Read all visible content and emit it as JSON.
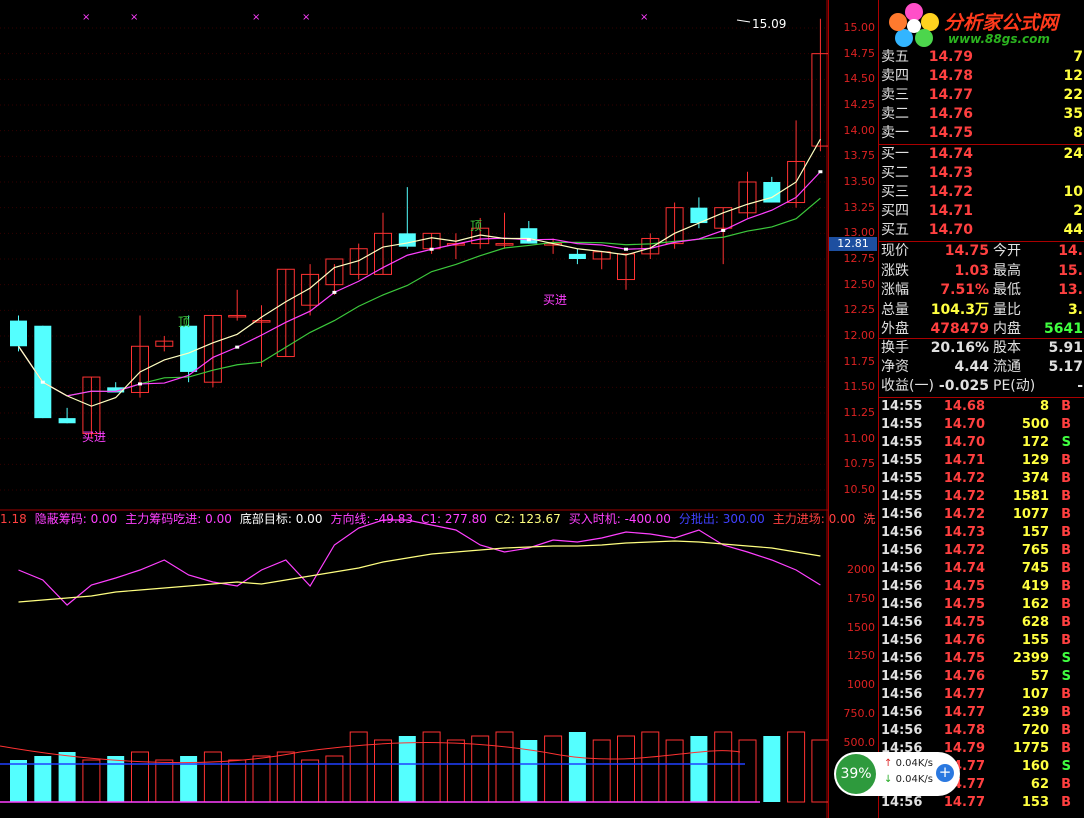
{
  "colors": {
    "up": "#ff3232",
    "down": "#54ffff",
    "ma5": "#ffffc0",
    "ma10": "#ff40ff",
    "ma20": "#3cc83c",
    "grid": "#a00000"
  },
  "chart": {
    "price_axis": [
      "15.00",
      "14.75",
      "14.50",
      "14.25",
      "14.00",
      "13.75",
      "13.50",
      "13.25",
      "13.00",
      "12.75",
      "12.50",
      "12.25",
      "12.00",
      "11.75",
      "11.50",
      "11.25",
      "11.00",
      "10.75",
      "10.50"
    ],
    "current_price_tag": "12.81",
    "high_label": "15.09",
    "signals": {
      "buy1": "买进",
      "buy2": "买进",
      "top1": "顶",
      "top2": "顶"
    },
    "indicator_axis": [
      "2000",
      "1750",
      "1500",
      "1250",
      "1000",
      "750.0",
      "500.0"
    ],
    "indicator_legend": [
      {
        "text": "1.18",
        "color": "#ff4040"
      },
      {
        "text": "隐蔽筹码: 0.00",
        "color": "#ff40ff"
      },
      {
        "text": "主力筹码吃进: 0.00",
        "color": "#ff40ff"
      },
      {
        "text": "底部目标: 0.00",
        "color": "#ffffff"
      },
      {
        "text": "方向线: -49.83",
        "color": "#ff40ff"
      },
      {
        "text": "C1: 277.80",
        "color": "#ff40ff"
      },
      {
        "text": "C2: 123.67",
        "color": "#ffff80"
      },
      {
        "text": "买入时机: -400.00",
        "color": "#ff40ff"
      },
      {
        "text": "分批出: 300.00",
        "color": "#4040ff"
      },
      {
        "text": "主力进场: 0.00",
        "color": "#ff4040"
      },
      {
        "text": "洗",
        "color": "#ff4040"
      }
    ]
  },
  "chart_data": {
    "type": "candlestick",
    "candles": [
      {
        "o": 12.15,
        "h": 12.2,
        "l": 11.85,
        "c": 11.9
      },
      {
        "o": 12.1,
        "h": 12.1,
        "l": 11.2,
        "c": 11.2
      },
      {
        "o": 11.2,
        "h": 11.3,
        "l": 11.15,
        "c": 11.15
      },
      {
        "o": 11.05,
        "h": 11.6,
        "l": 11.0,
        "c": 11.6
      },
      {
        "o": 11.5,
        "h": 11.55,
        "l": 11.45,
        "c": 11.45
      },
      {
        "o": 11.45,
        "h": 12.2,
        "l": 11.4,
        "c": 11.9
      },
      {
        "o": 11.9,
        "h": 12.0,
        "l": 11.85,
        "c": 11.95
      },
      {
        "o": 12.1,
        "h": 12.2,
        "l": 11.55,
        "c": 11.65
      },
      {
        "o": 11.55,
        "h": 12.2,
        "l": 11.5,
        "c": 12.2
      },
      {
        "o": 12.2,
        "h": 12.45,
        "l": 12.15,
        "c": 12.2
      },
      {
        "o": 12.15,
        "h": 12.3,
        "l": 11.7,
        "c": 12.15
      },
      {
        "o": 11.8,
        "h": 12.65,
        "l": 11.8,
        "c": 12.65
      },
      {
        "o": 12.3,
        "h": 12.7,
        "l": 12.2,
        "c": 12.6
      },
      {
        "o": 12.5,
        "h": 12.7,
        "l": 12.4,
        "c": 12.75
      },
      {
        "o": 12.6,
        "h": 12.9,
        "l": 12.55,
        "c": 12.85
      },
      {
        "o": 12.6,
        "h": 13.2,
        "l": 12.6,
        "c": 13.0
      },
      {
        "o": 13.0,
        "h": 13.45,
        "l": 12.85,
        "c": 12.87
      },
      {
        "o": 12.85,
        "h": 13.0,
        "l": 12.8,
        "c": 13.0
      },
      {
        "o": 12.9,
        "h": 13.0,
        "l": 12.75,
        "c": 12.9
      },
      {
        "o": 12.9,
        "h": 13.15,
        "l": 12.85,
        "c": 13.05
      },
      {
        "o": 12.9,
        "h": 13.2,
        "l": 12.85,
        "c": 12.9
      },
      {
        "o": 13.05,
        "h": 13.12,
        "l": 12.9,
        "c": 12.9
      },
      {
        "o": 12.9,
        "h": 12.95,
        "l": 12.8,
        "c": 12.9
      },
      {
        "o": 12.8,
        "h": 12.85,
        "l": 12.7,
        "c": 12.75
      },
      {
        "o": 12.75,
        "h": 12.82,
        "l": 12.65,
        "c": 12.82
      },
      {
        "o": 12.55,
        "h": 12.8,
        "l": 12.45,
        "c": 12.8
      },
      {
        "o": 12.8,
        "h": 13.0,
        "l": 12.75,
        "c": 12.95
      },
      {
        "o": 12.9,
        "h": 13.3,
        "l": 12.85,
        "c": 13.25
      },
      {
        "o": 13.25,
        "h": 13.35,
        "l": 13.05,
        "c": 13.1
      },
      {
        "o": 13.05,
        "h": 13.25,
        "l": 12.7,
        "c": 13.25
      },
      {
        "o": 13.2,
        "h": 13.6,
        "l": 13.15,
        "c": 13.5
      },
      {
        "o": 13.5,
        "h": 13.55,
        "l": 13.3,
        "c": 13.3
      },
      {
        "o": 13.3,
        "h": 14.1,
        "l": 13.25,
        "c": 13.7
      },
      {
        "o": 13.85,
        "h": 15.09,
        "l": 13.8,
        "c": 14.75
      }
    ]
  },
  "quote": {
    "asks": [
      {
        "label": "卖五",
        "price": "14.79",
        "vol": "7"
      },
      {
        "label": "卖四",
        "price": "14.78",
        "vol": "12"
      },
      {
        "label": "卖三",
        "price": "14.77",
        "vol": "22"
      },
      {
        "label": "卖二",
        "price": "14.76",
        "vol": "35"
      },
      {
        "label": "卖一",
        "price": "14.75",
        "vol": "8"
      }
    ],
    "bids": [
      {
        "label": "买一",
        "price": "14.74",
        "vol": "24"
      },
      {
        "label": "买二",
        "price": "14.73",
        "vol": ""
      },
      {
        "label": "买三",
        "price": "14.72",
        "vol": "10"
      },
      {
        "label": "买四",
        "price": "14.71",
        "vol": "2"
      },
      {
        "label": "买五",
        "price": "14.70",
        "vol": "44"
      }
    ],
    "stats1": [
      {
        "l1": "现价",
        "v1": "14.75",
        "l2": "今开",
        "v2": "14."
      },
      {
        "l1": "涨跌",
        "v1": "1.03",
        "l2": "最高",
        "v2": "15."
      },
      {
        "l1": "涨幅",
        "v1": "7.51%",
        "l2": "最低",
        "v2": "13."
      },
      {
        "l1": "总量",
        "v1": "104.3万",
        "l2": "量比",
        "v2": "3."
      },
      {
        "l1": "外盘",
        "v1": "478479",
        "l2": "内盘",
        "v2": "5641"
      }
    ],
    "stats2": [
      {
        "l1": "换手",
        "v1": "20.16%",
        "l2": "股本",
        "v2": "5.91"
      },
      {
        "l1": "净资",
        "v1": "4.44",
        "l2": "流通",
        "v2": "5.17"
      },
      {
        "l1": "收益(一)",
        "v1": "-0.025",
        "l2": "PE(动)",
        "v2": "-"
      }
    ],
    "ticks": [
      {
        "t": "14:55",
        "p": "14.68",
        "v": "8",
        "s": "B"
      },
      {
        "t": "14:55",
        "p": "14.70",
        "v": "500",
        "s": "B"
      },
      {
        "t": "14:55",
        "p": "14.70",
        "v": "172",
        "s": "S"
      },
      {
        "t": "14:55",
        "p": "14.71",
        "v": "129",
        "s": "B"
      },
      {
        "t": "14:55",
        "p": "14.72",
        "v": "374",
        "s": "B"
      },
      {
        "t": "14:55",
        "p": "14.72",
        "v": "1581",
        "s": "B"
      },
      {
        "t": "14:56",
        "p": "14.72",
        "v": "1077",
        "s": "B"
      },
      {
        "t": "14:56",
        "p": "14.73",
        "v": "157",
        "s": "B"
      },
      {
        "t": "14:56",
        "p": "14.72",
        "v": "765",
        "s": "B"
      },
      {
        "t": "14:56",
        "p": "14.74",
        "v": "745",
        "s": "B"
      },
      {
        "t": "14:56",
        "p": "14.75",
        "v": "419",
        "s": "B"
      },
      {
        "t": "14:56",
        "p": "14.75",
        "v": "162",
        "s": "B"
      },
      {
        "t": "14:56",
        "p": "14.75",
        "v": "628",
        "s": "B"
      },
      {
        "t": "14:56",
        "p": "14.76",
        "v": "155",
        "s": "B"
      },
      {
        "t": "14:56",
        "p": "14.75",
        "v": "2399",
        "s": "S"
      },
      {
        "t": "14:56",
        "p": "14.76",
        "v": "57",
        "s": "S"
      },
      {
        "t": "14:56",
        "p": "14.77",
        "v": "107",
        "s": "B"
      },
      {
        "t": "14:56",
        "p": "14.77",
        "v": "239",
        "s": "B"
      },
      {
        "t": "14:56",
        "p": "14.78",
        "v": "720",
        "s": "B"
      },
      {
        "t": "14:56",
        "p": "14.79",
        "v": "1775",
        "s": "B"
      },
      {
        "t": "14:56",
        "p": "14.77",
        "v": "160",
        "s": "S"
      },
      {
        "t": "14:56",
        "p": "14.77",
        "v": "62",
        "s": "B"
      },
      {
        "t": "14:56",
        "p": "14.77",
        "v": "153",
        "s": "B"
      }
    ]
  },
  "logo": {
    "title": "分析家公式网",
    "url": "www.88gs.com"
  },
  "net": {
    "percent": "39%",
    "up": "0.04K/s",
    "down": "0.04K/s",
    "plus": "+"
  }
}
